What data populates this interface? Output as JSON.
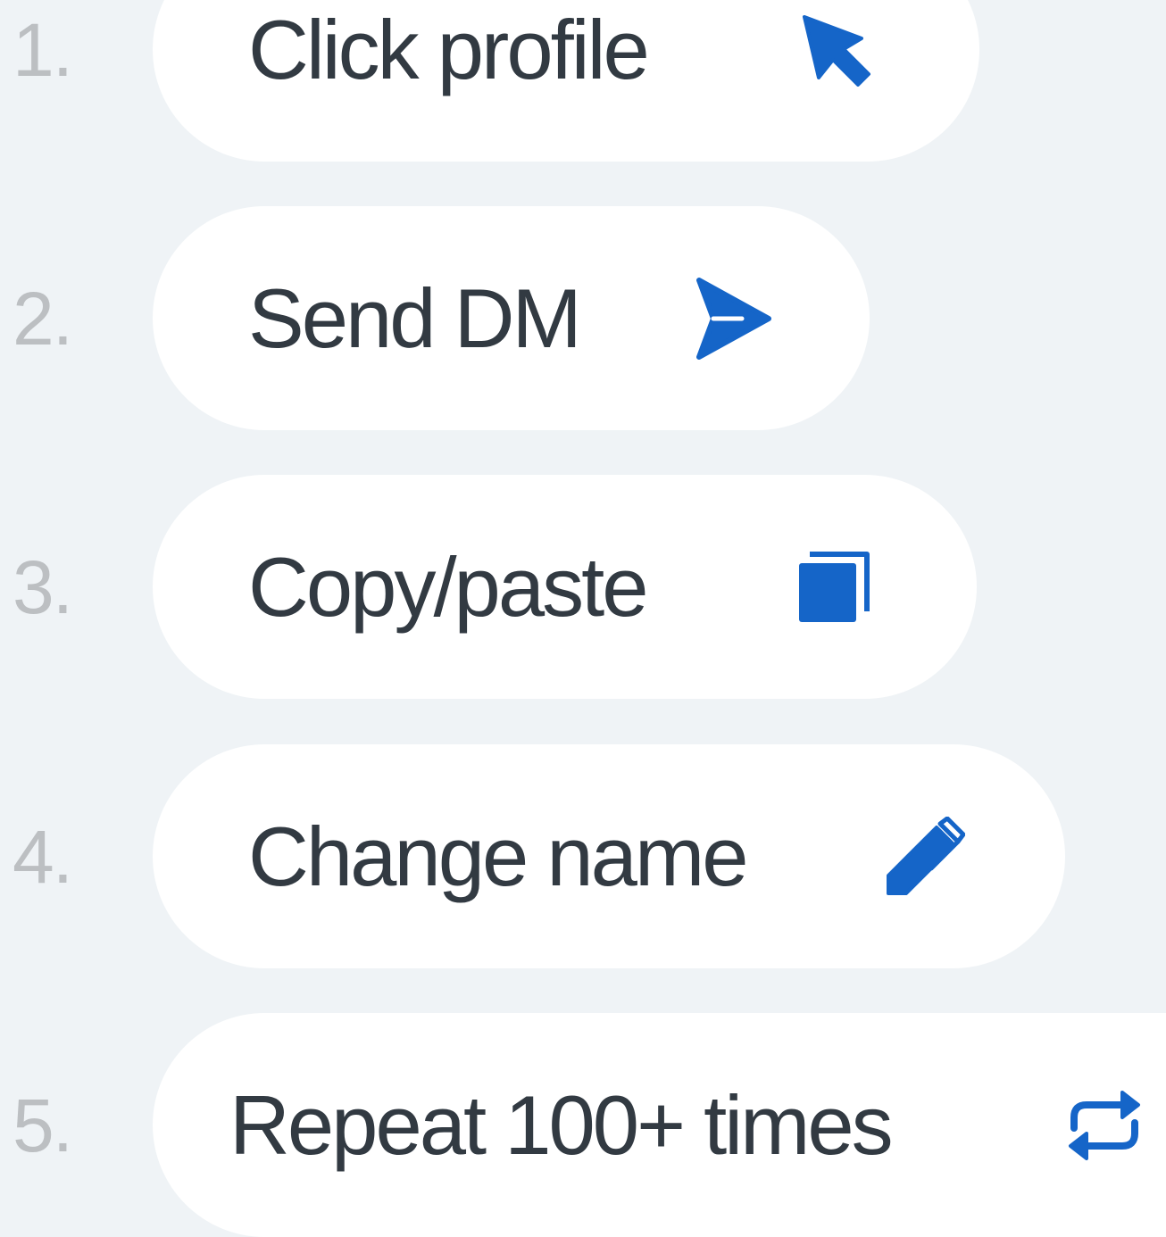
{
  "steps": [
    {
      "number": "1.",
      "label": "Click profile",
      "icon": "cursor-arrow-icon"
    },
    {
      "number": "2.",
      "label": "Send DM",
      "icon": "send-icon"
    },
    {
      "number": "3.",
      "label": "Copy/paste",
      "icon": "copy-icon"
    },
    {
      "number": "4.",
      "label": "Change name",
      "icon": "pen-icon"
    },
    {
      "number": "5.",
      "label": "Repeat 100+ times",
      "icon": "repeat-icon"
    }
  ],
  "colors": {
    "background": "#eff3f6",
    "pill": "#ffffff",
    "text": "#323a42",
    "number": "#bcbfc2",
    "accent": "#1565c8"
  }
}
